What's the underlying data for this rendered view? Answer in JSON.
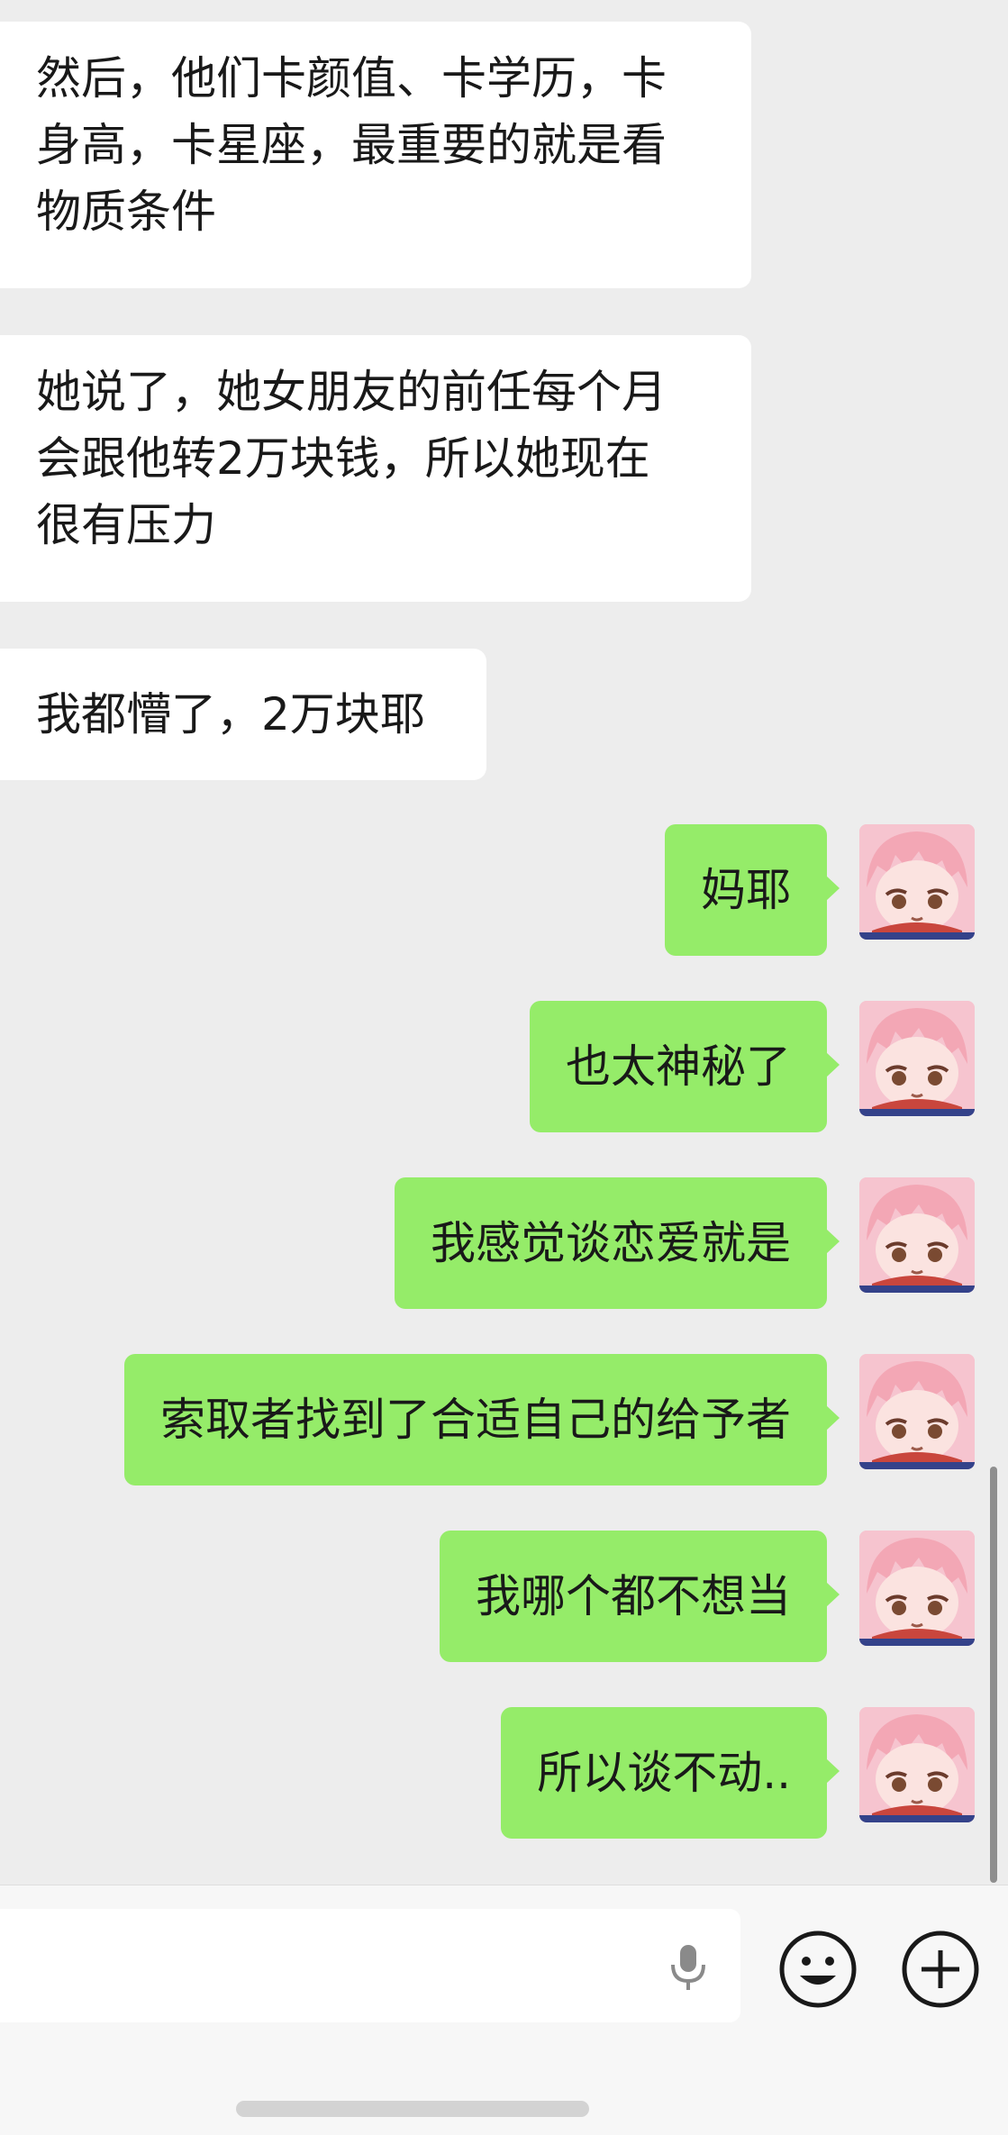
{
  "messages_in": [
    {
      "lines": [
        "然后，他们卡颜值、卡学历，卡",
        "身高，卡星座，最重要的就是看",
        "物质条件"
      ]
    },
    {
      "lines": [
        "她说了，她女朋友的前任每个月",
        "会跟他转2万块钱，所以她现在",
        "很有压力"
      ]
    },
    {
      "lines": [
        "我都懵了，2万块耶"
      ]
    }
  ],
  "messages_out": [
    {
      "text": "妈耶"
    },
    {
      "text": "也太神秘了"
    },
    {
      "text": "我感觉谈恋爱就是"
    },
    {
      "text": "索取者找到了合适自己的给予者"
    },
    {
      "text": "我哪个都不想当"
    },
    {
      "text": "所以谈不动.."
    }
  ],
  "input_bar": {
    "icons": [
      "microphone-icon",
      "emoji-icon",
      "plus-icon"
    ]
  },
  "colors": {
    "background": "#ededed",
    "incoming_bubble": "#ffffff",
    "outgoing_bubble": "#95ec69",
    "text": "#191919"
  }
}
